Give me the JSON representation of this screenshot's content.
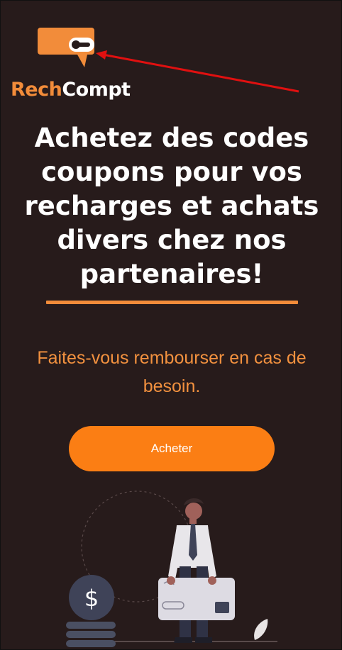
{
  "brand": {
    "name_part1": "Rech",
    "name_part2": "Compt",
    "accent_color": "#f28c3a"
  },
  "hero": {
    "headline": "Achetez des codes coupons pour vos recharges et achats divers chez nos partenaires!",
    "subtext": "Faites-vous rembourser en cas de besoin."
  },
  "cta": {
    "label": "Acheter",
    "color": "#fb7e14"
  },
  "illustration": {
    "coin_symbol": "$"
  },
  "annotation": {
    "arrow_color": "#e01010"
  },
  "theme": {
    "background": "#271b1b",
    "text": "#ffffff"
  }
}
